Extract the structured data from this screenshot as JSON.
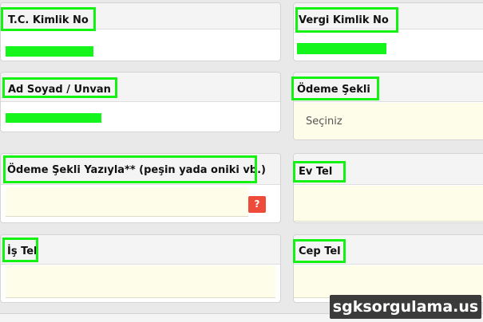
{
  "fields": {
    "tc_kimlik_no": {
      "label": "T.C. Kimlik No"
    },
    "vergi_kimlik_no": {
      "label": "Vergi Kimlik No"
    },
    "ad_soyad_unvan": {
      "label": "Ad Soyad / Unvan"
    },
    "odeme_sekli": {
      "label": "Ödeme Şekli",
      "selected": "Seçiniz"
    },
    "odeme_sekli_yaziyla": {
      "label": "Ödeme Şekli Yazıyla** (peşin yada oniki vb.)",
      "help": "?"
    },
    "ev_tel": {
      "label": "Ev Tel"
    },
    "is_tel": {
      "label": "İş Tel"
    },
    "cep_tel": {
      "label": "Cep Tel"
    }
  },
  "watermark": "sgksorgulama.us",
  "colors": {
    "highlight": "#13f213",
    "redaction": "#14f51c",
    "help_button": "#ee4b3b",
    "input_bg": "#fdfde9"
  }
}
